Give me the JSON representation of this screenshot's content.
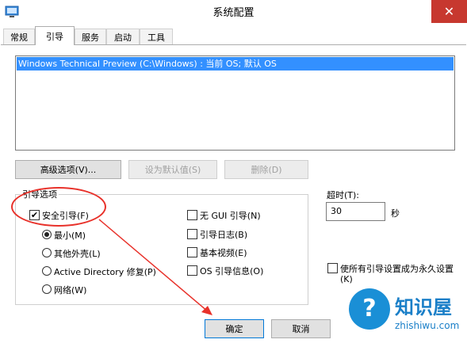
{
  "window": {
    "title": "系统配置",
    "close_glyph": "✕"
  },
  "tabs": [
    "常规",
    "引导",
    "服务",
    "启动",
    "工具"
  ],
  "boot_list": {
    "entries": [
      "Windows Technical Preview (C:\\Windows) : 当前 OS; 默认 OS"
    ]
  },
  "buttons": {
    "advanced": "高级选项(V)...",
    "set_default": "设为默认值(S)",
    "delete": "删除(D)",
    "ok": "确定",
    "cancel": "取消"
  },
  "boot_options": {
    "legend": "引导选项",
    "safe_boot": {
      "label": "安全引导(F)",
      "checked": true
    },
    "radios": [
      {
        "label": "最小(M)",
        "selected": true
      },
      {
        "label": "其他外壳(L)",
        "selected": false
      },
      {
        "label": "Active Directory 修复(P)",
        "selected": false
      },
      {
        "label": "网络(W)",
        "selected": false
      }
    ],
    "checkboxes": [
      {
        "label": "无 GUI 引导(N)",
        "checked": false
      },
      {
        "label": "引导日志(B)",
        "checked": false
      },
      {
        "label": "基本视频(E)",
        "checked": false
      },
      {
        "label": "OS 引导信息(O)",
        "checked": false
      }
    ]
  },
  "timeout": {
    "label": "超时(T):",
    "value": "30",
    "unit": "秒"
  },
  "permanent": {
    "label_line1": "使所有引导设置成为永久设置",
    "label_line2": "(K)",
    "checked": false
  },
  "watermark": {
    "name": "知识屋",
    "url": "zhishiwu.com"
  },
  "colors": {
    "highlight": "#e8312a",
    "selection": "#3390ff",
    "close_button": "#c7382f"
  }
}
